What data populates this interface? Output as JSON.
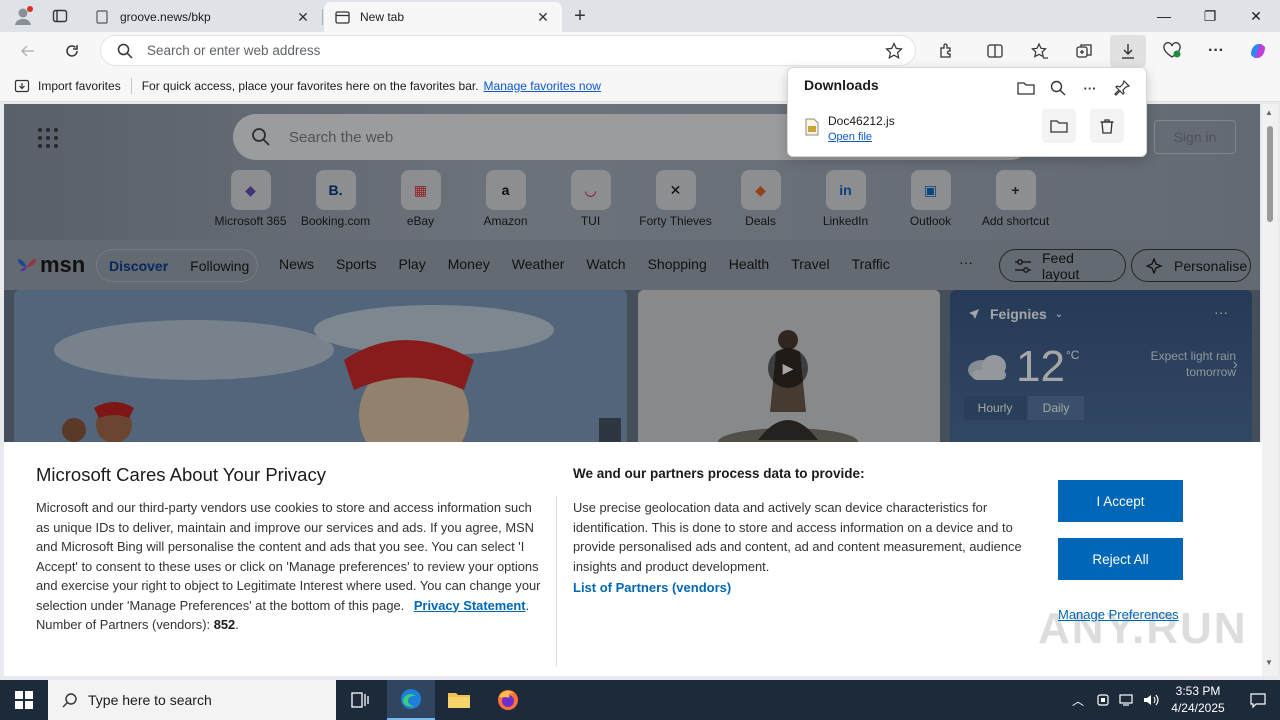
{
  "tabs": [
    {
      "title": "groove.news/bkp"
    },
    {
      "title": "New tab"
    }
  ],
  "address_bar": {
    "placeholder": "Search or enter web address"
  },
  "favorites_bar": {
    "import_label": "Import favorites",
    "hint": "For quick access, place your favorites here on the favorites bar.",
    "manage_link": "Manage favorites now"
  },
  "new_tab": {
    "search_placeholder": "Search the web",
    "sign_in": "Sign in",
    "shortcuts": [
      {
        "label": "Microsoft 365",
        "icon": "m365-icon",
        "glyph": "◆",
        "color": "#6b4fbb"
      },
      {
        "label": "Booking.com",
        "icon": "booking-icon",
        "glyph": "B.",
        "color": "#003580"
      },
      {
        "label": "eBay",
        "icon": "ebay-icon",
        "glyph": "▦",
        "color": "#e53238"
      },
      {
        "label": "Amazon",
        "icon": "amazon-icon",
        "glyph": "a",
        "color": "#111111"
      },
      {
        "label": "TUI",
        "icon": "tui-icon",
        "glyph": "◡",
        "color": "#d40e14"
      },
      {
        "label": "Forty Thieves",
        "icon": "swords-icon",
        "glyph": "✕",
        "color": "#111111"
      },
      {
        "label": "Deals",
        "icon": "deals-icon",
        "glyph": "◆",
        "color": "#e8642c"
      },
      {
        "label": "LinkedIn",
        "icon": "linkedin-icon",
        "glyph": "in",
        "color": "#0a66c2"
      },
      {
        "label": "Outlook",
        "icon": "outlook-icon",
        "glyph": "▣",
        "color": "#0f6cbd"
      },
      {
        "label": "Add shortcut",
        "icon": "plus-icon",
        "glyph": "+",
        "color": "#333333"
      }
    ],
    "msn": {
      "logo": "msn",
      "discover": "Discover",
      "following": "Following",
      "categories": [
        "News",
        "Sports",
        "Play",
        "Money",
        "Weather",
        "Watch",
        "Shopping",
        "Health",
        "Travel",
        "Traffic"
      ],
      "more": "···",
      "feed_layout": "Feed layout",
      "personalise": "Personalise"
    },
    "weather": {
      "location": "Feignies",
      "temperature": "12",
      "unit": "°C",
      "forecast": "Expect light rain tomorrow",
      "tab_hourly": "Hourly",
      "tab_daily": "Daily"
    }
  },
  "downloads": {
    "title": "Downloads",
    "file_name": "Doc46212.js",
    "open_file": "Open file"
  },
  "privacy": {
    "title": "Microsoft Cares About Your Privacy",
    "body": "Microsoft and our third-party vendors use cookies to store and access information such as unique IDs to deliver, maintain and improve our services and ads. If you agree, MSN and Microsoft Bing will personalise the content and ads that you see. You can select 'I Accept' to consent to these uses or click on 'Manage preferences' to review your options and exercise your right to object to Legitimate Interest where used.  You can change your selection under 'Manage Preferences' at the bottom of this page.",
    "privacy_link": "Privacy Statement",
    "partners_label": "Number of Partners (vendors):",
    "partners_count": "852",
    "data_title": "We and our partners process data to provide:",
    "data_body": "Use precise geolocation data and actively scan device characteristics for identification. This is done to store and access information on a device and to provide personalised ads and content, ad and content measurement, audience insights and product development.",
    "partners_link": "List of Partners (vendors)",
    "accept": "I Accept",
    "reject": "Reject All",
    "manage": "Manage Preferences",
    "watermark": "ANY.RUN"
  },
  "taskbar": {
    "search_placeholder": "Type here to search",
    "time": "3:53 PM",
    "date": "4/24/2025"
  }
}
